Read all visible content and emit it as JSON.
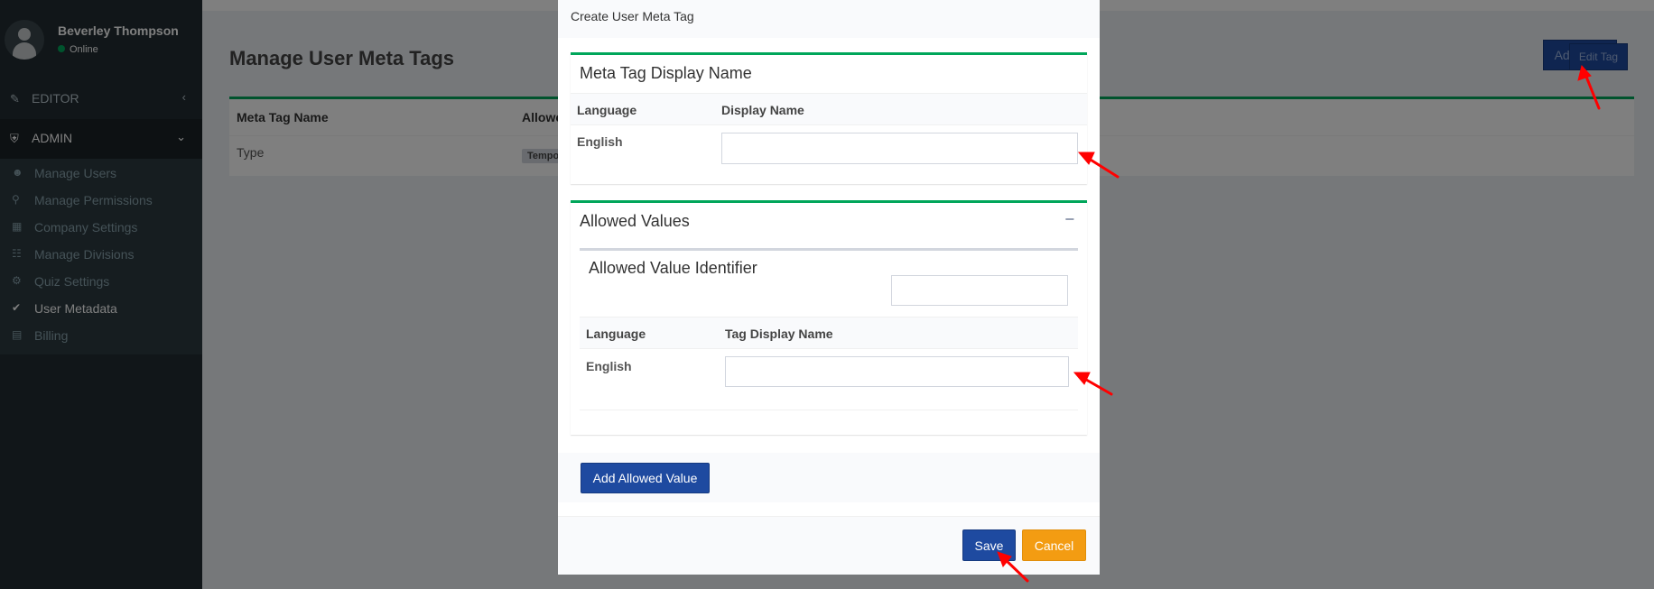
{
  "sidebar": {
    "user": {
      "name": "Beverley Thompson",
      "status": "Online"
    },
    "sections": [
      {
        "label": "EDITOR",
        "icon": "edit-icon",
        "chevron": "chevron-left-icon"
      },
      {
        "label": "ADMIN",
        "icon": "shield-icon",
        "chevron": "chevron-down-icon"
      }
    ],
    "items": [
      {
        "label": "Manage Users",
        "icon": "users-icon"
      },
      {
        "label": "Manage Permissions",
        "icon": "key-icon"
      },
      {
        "label": "Company Settings",
        "icon": "building-icon"
      },
      {
        "label": "Manage Divisions",
        "icon": "sitemap-icon"
      },
      {
        "label": "Quiz Settings",
        "icon": "gear-icon"
      },
      {
        "label": "User Metadata",
        "icon": "tag-icon",
        "current": true
      },
      {
        "label": "Billing",
        "icon": "receipt-icon"
      }
    ]
  },
  "main": {
    "title": "Manage User Meta Tags",
    "add_new_label": "Add New",
    "table": {
      "headers": [
        "Meta Tag Name",
        "Allowe"
      ],
      "rows": [
        {
          "name": "Type",
          "badge": "Tempo",
          "action": "Edit Tag"
        }
      ]
    }
  },
  "modal": {
    "title": "Create User Meta Tag",
    "display_name_panel": {
      "title": "Meta Tag Display Name",
      "headers": [
        "Language",
        "Display Name"
      ],
      "row_language": "English",
      "input_value": ""
    },
    "allowed_values_panel": {
      "title": "Allowed Values",
      "collapse_symbol": "−",
      "identifier_title": "Allowed Value Identifier",
      "identifier_value": "",
      "headers": [
        "Language",
        "Tag Display Name"
      ],
      "row_language": "English",
      "input_value": ""
    },
    "add_allowed_value_label": "Add Allowed Value",
    "save_label": "Save",
    "cancel_label": "Cancel"
  },
  "colors": {
    "sidebar_bg": "#222d32",
    "primary": "#1e4aa0",
    "success": "#00a65a",
    "warning": "#f39c12",
    "annotation_arrow": "#ff0000"
  }
}
